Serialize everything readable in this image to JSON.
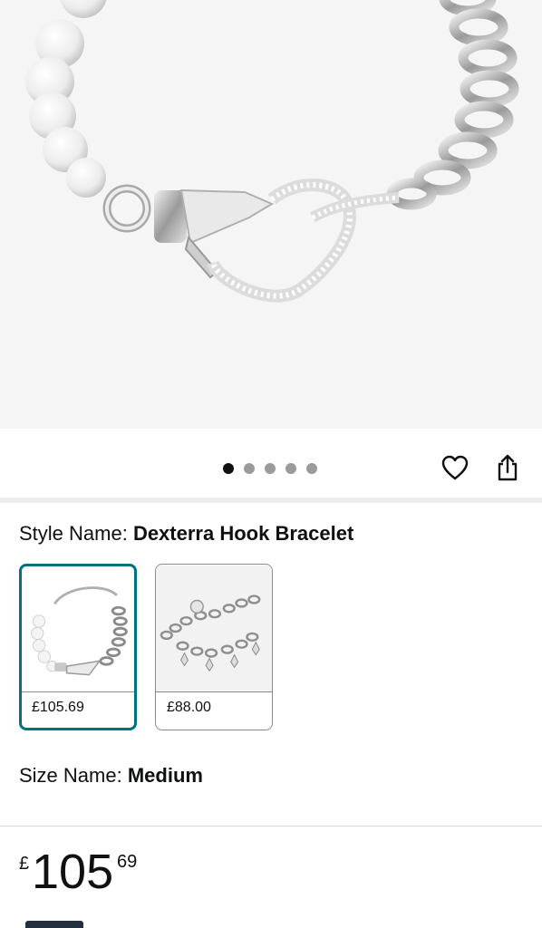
{
  "product_image": {
    "alt": ""
  },
  "carousel": {
    "dot_count": 5,
    "active_index": 0
  },
  "actions": {
    "wishlist_icon": "heart-outline-icon",
    "share_icon": "share-icon"
  },
  "style": {
    "label": "Style Name: ",
    "value": "Dexterra Hook Bracelet",
    "options": [
      {
        "price": "£105.69",
        "selected": true
      },
      {
        "price": "£88.00",
        "selected": false
      }
    ]
  },
  "size": {
    "label": "Size Name: ",
    "value": "Medium"
  },
  "price": {
    "currency": "£",
    "whole": "105",
    "fraction": "69"
  },
  "colors": {
    "accent": "#007185",
    "text": "#0f1111",
    "hero_bg": "#f5f5f5"
  }
}
